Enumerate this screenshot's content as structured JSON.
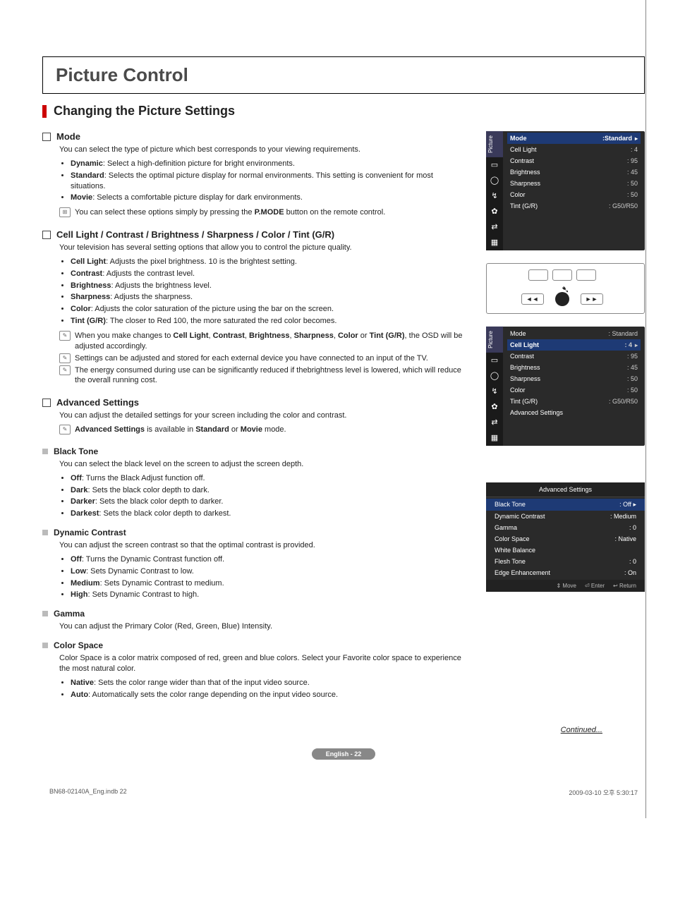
{
  "title": "Picture Control",
  "subheading": "Changing the Picture Settings",
  "sections": {
    "mode": {
      "title": "Mode",
      "intro": "You can select the type of picture which best corresponds to your viewing requirements.",
      "items": [
        {
          "b": "Dynamic",
          "t": ": Select a high-definition picture for bright environments."
        },
        {
          "b": "Standard",
          "t": ": Selects the optimal picture display for normal environments. This setting is convenient for most situations."
        },
        {
          "b": "Movie",
          "t": ": Selects a comfortable picture display for dark environments."
        }
      ],
      "note_pre": "You can select these options simply by pressing the ",
      "note_bold": "P.MODE",
      "note_post": " button on the remote control."
    },
    "settings": {
      "title": "Cell Light / Contrast / Brightness / Sharpness / Color / Tint (G/R)",
      "intro": "Your television has several setting options that allow you to control the picture quality.",
      "items": [
        {
          "b": "Cell Light",
          "t": ": Adjusts the pixel brightness. 10 is the brightest setting."
        },
        {
          "b": "Contrast",
          "t": ": Adjusts the contrast level."
        },
        {
          "b": "Brightness",
          "t": ": Adjusts the brightness level."
        },
        {
          "b": "Sharpness",
          "t": ": Adjusts the sharpness."
        },
        {
          "b": "Color",
          "t": ": Adjusts the color saturation of the picture using the bar on the screen."
        },
        {
          "b": "Tint (G/R)",
          "t": ": The closer to Red 100, the more saturated the red color becomes."
        }
      ],
      "note1_pre": "When you make changes to ",
      "note1_bold": [
        "Cell Light",
        "Contrast",
        "Brightness",
        "Sharpness",
        "Color",
        "Tint (G/R)"
      ],
      "note1_post": ", the OSD will be adjusted accordingly.",
      "note2": "Settings can be adjusted and stored for each external device you have connected to an input of the TV.",
      "note3": "The energy consumed during use can be significantly reduced if thebrightness level is lowered, which will reduce the overall running cost."
    },
    "advanced": {
      "title": "Advanced Settings",
      "intro": "You can adjust the detailed settings for your screen including the color and contrast.",
      "note_b1": "Advanced Settings",
      "note_mid": " is available in ",
      "note_b2": "Standard",
      "note_or": " or ",
      "note_b3": "Movie",
      "note_end": " mode."
    },
    "black_tone": {
      "title": "Black Tone",
      "intro": "You can select the black level on the screen to adjust the screen depth.",
      "items": [
        {
          "b": "Off",
          "t": ": Turns the Black Adjust function off."
        },
        {
          "b": "Dark",
          "t": ": Sets the black color depth to dark."
        },
        {
          "b": "Darker",
          "t": ": Sets the black color depth to darker."
        },
        {
          "b": "Darkest",
          "t": ": Sets the black color depth to darkest."
        }
      ]
    },
    "dyn_contrast": {
      "title": "Dynamic Contrast",
      "intro": "You can adjust the screen contrast so that the optimal contrast is provided.",
      "items": [
        {
          "b": "Off",
          "t": ": Turns the Dynamic Contrast function off."
        },
        {
          "b": "Low",
          "t": ": Sets Dynamic Contrast to low."
        },
        {
          "b": "Medium",
          "t": ": Sets Dynamic Contrast to medium."
        },
        {
          "b": "High",
          "t": ": Sets Dynamic Contrast to high."
        }
      ]
    },
    "gamma": {
      "title": "Gamma",
      "intro": "You can adjust the Primary Color (Red, Green, Blue) Intensity."
    },
    "color_space": {
      "title": "Color Space",
      "intro": "Color Space is a color matrix composed of red, green and blue colors. Select your Favorite color space to experience the most natural color.",
      "items": [
        {
          "b": "Native",
          "t": ": Sets the color range wider than that of the input video source."
        },
        {
          "b": "Auto",
          "t": ": Automatically sets the color range depending on the input video source."
        }
      ]
    }
  },
  "osd1": {
    "tab": "Picture",
    "header": {
      "k": "Mode",
      "v": ":Standard"
    },
    "rows": [
      {
        "k": "Cell Light",
        "v": ": 4"
      },
      {
        "k": "Contrast",
        "v": ": 95"
      },
      {
        "k": "Brightness",
        "v": ": 45"
      },
      {
        "k": "Sharpness",
        "v": ": 50"
      },
      {
        "k": "Color",
        "v": ": 50"
      },
      {
        "k": "Tint (G/R)",
        "v": ": G50/R50"
      }
    ]
  },
  "osd2": {
    "tab": "Picture",
    "top": {
      "k": "Mode",
      "v": ": Standard"
    },
    "sel": {
      "k": "Cell Light",
      "v": ": 4"
    },
    "rows": [
      {
        "k": "Contrast",
        "v": ": 95"
      },
      {
        "k": "Brightness",
        "v": ": 45"
      },
      {
        "k": "Sharpness",
        "v": ": 50"
      },
      {
        "k": "Color",
        "v": ": 50"
      },
      {
        "k": "Tint (G/R)",
        "v": ": G50/R50"
      },
      {
        "k": "Advanced Settings",
        "v": ""
      }
    ]
  },
  "adv_panel": {
    "title": "Advanced Settings",
    "rows": [
      {
        "k": "Black Tone",
        "v": ": Off",
        "sel": true
      },
      {
        "k": "Dynamic Contrast",
        "v": ": Medium"
      },
      {
        "k": "Gamma",
        "v": ": 0"
      },
      {
        "k": "Color Space",
        "v": ": Native"
      },
      {
        "k": "White Balance",
        "v": ""
      },
      {
        "k": "Flesh Tone",
        "v": ": 0"
      },
      {
        "k": "Edge Enhancement",
        "v": ": On"
      }
    ],
    "footer": {
      "move": "Move",
      "enter": "Enter",
      "ret": "Return"
    }
  },
  "remote": {
    "rev": "◄◄",
    "fwd": "►►"
  },
  "continued": "Continued...",
  "page_label": "English - 22",
  "print_footer": {
    "left": "BN68-02140A_Eng.indb   22",
    "right": "2009-03-10   오후 5:30:17"
  }
}
